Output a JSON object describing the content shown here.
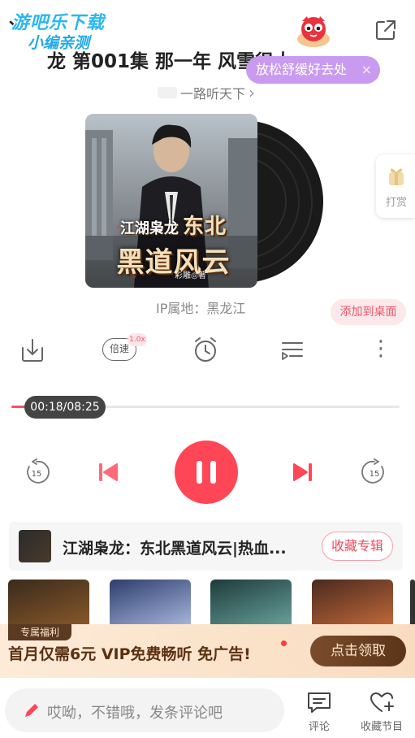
{
  "watermark": {
    "line1": "游吧乐下载",
    "line2": "小编亲测"
  },
  "header": {
    "title": "龙 第001集 那一年 风雪很大",
    "bubble_text": "放松舒缓好去处",
    "bubble_close": "×",
    "author": "一路听天下",
    "author_arrow": "›"
  },
  "cover": {
    "small_title": "江湖枭龙",
    "big_title_1": "东北",
    "big_title_2": "黑道风云",
    "credit": "彩雕◎著"
  },
  "side_tip": {
    "label": "打赏"
  },
  "ip_location": "IP属地：黑龙江",
  "add_to_desktop": "添加到桌面",
  "controls": {
    "speed_label": "倍速",
    "speed_value": "1.0x",
    "more": "⋮"
  },
  "progress": {
    "time": "00:18/08:25",
    "fraction": 0.036
  },
  "player": {
    "rewind_seconds": "15",
    "forward_seconds": "15"
  },
  "album": {
    "name": "江湖枭龙：东北黑道风云|热血...",
    "collect_button": "收藏专辑"
  },
  "promo": {
    "tag": "专属福利",
    "text": "首月仅需6元  VIP免费畅听  免广告!",
    "button": "点击领取"
  },
  "bottom_bar": {
    "comment_placeholder": "哎呦，不错哦，发条评论吧",
    "comment_label": "评论",
    "favorite_label": "收藏节目"
  },
  "colors": {
    "accent": "#ff4656",
    "bubble": "#c89bf0",
    "promo_brown": "#5b3418"
  }
}
